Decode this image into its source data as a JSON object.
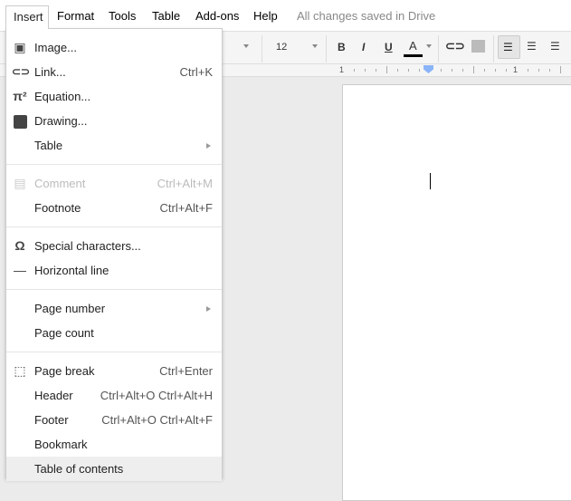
{
  "menubar": {
    "items": [
      "Insert",
      "Format",
      "Tools",
      "Table",
      "Add-ons",
      "Help"
    ],
    "status": "All changes saved in Drive"
  },
  "toolbar": {
    "font_size": "12",
    "bold": "B",
    "italic": "I",
    "underline": "U",
    "text_color": "A",
    "text_color_value": "#000000"
  },
  "ruler": {
    "left": "1",
    "right": "1"
  },
  "menu": {
    "image": {
      "label": "Image...",
      "icon": "image-icon"
    },
    "link": {
      "label": "Link...",
      "shortcut": "Ctrl+K",
      "icon": "link-icon"
    },
    "equation": {
      "label": "Equation...",
      "icon": "pi-icon"
    },
    "drawing": {
      "label": "Drawing...",
      "icon": "drawing-icon"
    },
    "table": {
      "label": "Table"
    },
    "comment": {
      "label": "Comment",
      "shortcut": "Ctrl+Alt+M",
      "disabled": true
    },
    "footnote": {
      "label": "Footnote",
      "shortcut": "Ctrl+Alt+F"
    },
    "special": {
      "label": "Special characters...",
      "icon": "omega-icon"
    },
    "hline": {
      "label": "Horizontal line"
    },
    "page_number": {
      "label": "Page number"
    },
    "page_count": {
      "label": "Page count"
    },
    "page_break": {
      "label": "Page break",
      "shortcut": "Ctrl+Enter"
    },
    "header": {
      "label": "Header",
      "shortcut": "Ctrl+Alt+O Ctrl+Alt+H"
    },
    "footer": {
      "label": "Footer",
      "shortcut": "Ctrl+Alt+O Ctrl+Alt+F"
    },
    "bookmark": {
      "label": "Bookmark"
    },
    "toc": {
      "label": "Table of contents",
      "highlighted": true
    }
  }
}
